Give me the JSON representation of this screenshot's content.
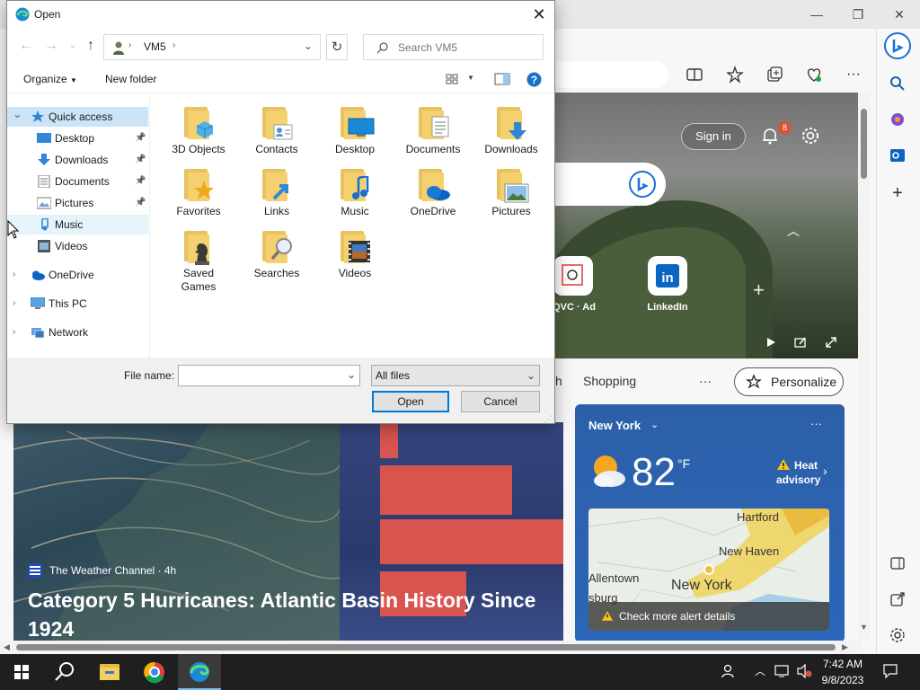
{
  "colors": {
    "edge_accent": "#0078d7",
    "notif": "#d8533c",
    "folder": "#f4d06f",
    "weather_card": "#2b66b8",
    "taskbar": "#1f1f1f"
  },
  "dialog": {
    "title": "Open",
    "breadcrumb": {
      "root_icon": "user-folder-icon",
      "path": "VM5"
    },
    "search_placeholder": "Search VM5",
    "commands": {
      "organize": "Organize",
      "new_folder": "New folder"
    },
    "tree": [
      {
        "label": "Quick access",
        "icon": "star-icon",
        "level": 0,
        "expanded": true,
        "selected": true
      },
      {
        "label": "Desktop",
        "icon": "desktop-icon",
        "level": 1,
        "pinned": true
      },
      {
        "label": "Downloads",
        "icon": "download-icon",
        "level": 1,
        "pinned": true
      },
      {
        "label": "Documents",
        "icon": "documents-icon",
        "level": 1,
        "pinned": true
      },
      {
        "label": "Pictures",
        "icon": "pictures-icon",
        "level": 1,
        "pinned": true
      },
      {
        "label": "Music",
        "icon": "music-icon",
        "level": 1,
        "hover": true
      },
      {
        "label": "Videos",
        "icon": "videos-icon",
        "level": 1
      },
      {
        "label": "OneDrive",
        "icon": "onedrive-icon",
        "level": 0
      },
      {
        "label": "This PC",
        "icon": "pc-icon",
        "level": 0
      },
      {
        "label": "Network",
        "icon": "network-icon",
        "level": 0
      }
    ],
    "files": [
      {
        "label": "3D Objects",
        "overlay": "cube"
      },
      {
        "label": "Contacts",
        "overlay": "contact"
      },
      {
        "label": "Desktop",
        "overlay": "monitor"
      },
      {
        "label": "Documents",
        "overlay": "doc"
      },
      {
        "label": "Downloads",
        "overlay": "arrow"
      },
      {
        "label": "Favorites",
        "overlay": "star"
      },
      {
        "label": "Links",
        "overlay": "link"
      },
      {
        "label": "Music",
        "overlay": "note"
      },
      {
        "label": "OneDrive",
        "overlay": "cloud"
      },
      {
        "label": "Pictures",
        "overlay": "picture"
      },
      {
        "label": "Saved Games",
        "overlay": "chess"
      },
      {
        "label": "Searches",
        "overlay": "magnifier"
      },
      {
        "label": "Videos",
        "overlay": "film"
      }
    ],
    "file_name_label": "File name:",
    "file_name_value": "",
    "file_type": "All files",
    "open_button": "Open",
    "cancel_button": "Cancel"
  },
  "browser": {
    "sign_in": "Sign in",
    "notification_count": "8",
    "quick_links": [
      "QVC · Ad",
      "LinkedIn"
    ],
    "nav_partial": "h",
    "nav_shopping": "Shopping",
    "nav_more": "···",
    "personalize": "Personalize",
    "weather": {
      "city": "New York",
      "temp": "82",
      "unit": "°F",
      "alert_line1": "Heat",
      "alert_line2": "advisory",
      "map_labels": [
        "Hartford",
        "New Haven",
        "Allentown",
        "New York",
        "sburg"
      ],
      "alert_link": "Check more alert details",
      "more": "···"
    },
    "news": {
      "source": "The Weather Channel · 4h",
      "headline": "Category 5 Hurricanes: Atlantic Basin History Since 1924"
    }
  },
  "taskbar": {
    "time": "7:42 AM",
    "date": "9/8/2023"
  }
}
